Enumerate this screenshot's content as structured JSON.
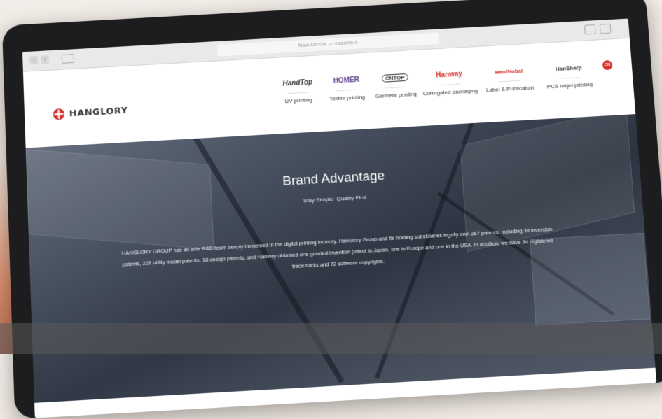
{
  "browser": {
    "address_text": "Navi.simula — vegafra.it",
    "back_icon": "chevron-left-icon",
    "forward_icon": "chevron-right-icon",
    "share_icon": "share-icon",
    "tabs_icon": "tabs-icon"
  },
  "site": {
    "logo_text": "HANGLORY",
    "lang_badge": "CN",
    "brand_color": "#d8312a",
    "nav": [
      {
        "brand": "HandTop",
        "label": "UV printing"
      },
      {
        "brand": "HOMER",
        "label": "Textile printing"
      },
      {
        "brand": "CNTOP",
        "label": "Garment printing"
      },
      {
        "brand": "Hanway",
        "label": "Corrugated packaging"
      },
      {
        "brand": "HanGlobal",
        "label": "Label & Publication"
      },
      {
        "brand": "HanSharp",
        "label": "PCB inkjet printing"
      }
    ]
  },
  "hero": {
    "title": "Brand Advantage",
    "subtitle": "Stay Simple· Quality First",
    "body": "HANGLORY GROUP has an elite R&D team deeply immersed in the digital printing industry. HanGlory Group and its holding subsidiaries legally own 287 patents, including 38 invention patents, 228 utility model patents, 18 design patents, and Hanway obtained one granted invention patent in Japan, one in Europe and one in the USA. In addition, we have 34 registered trademarks and 72 software copyrights."
  }
}
